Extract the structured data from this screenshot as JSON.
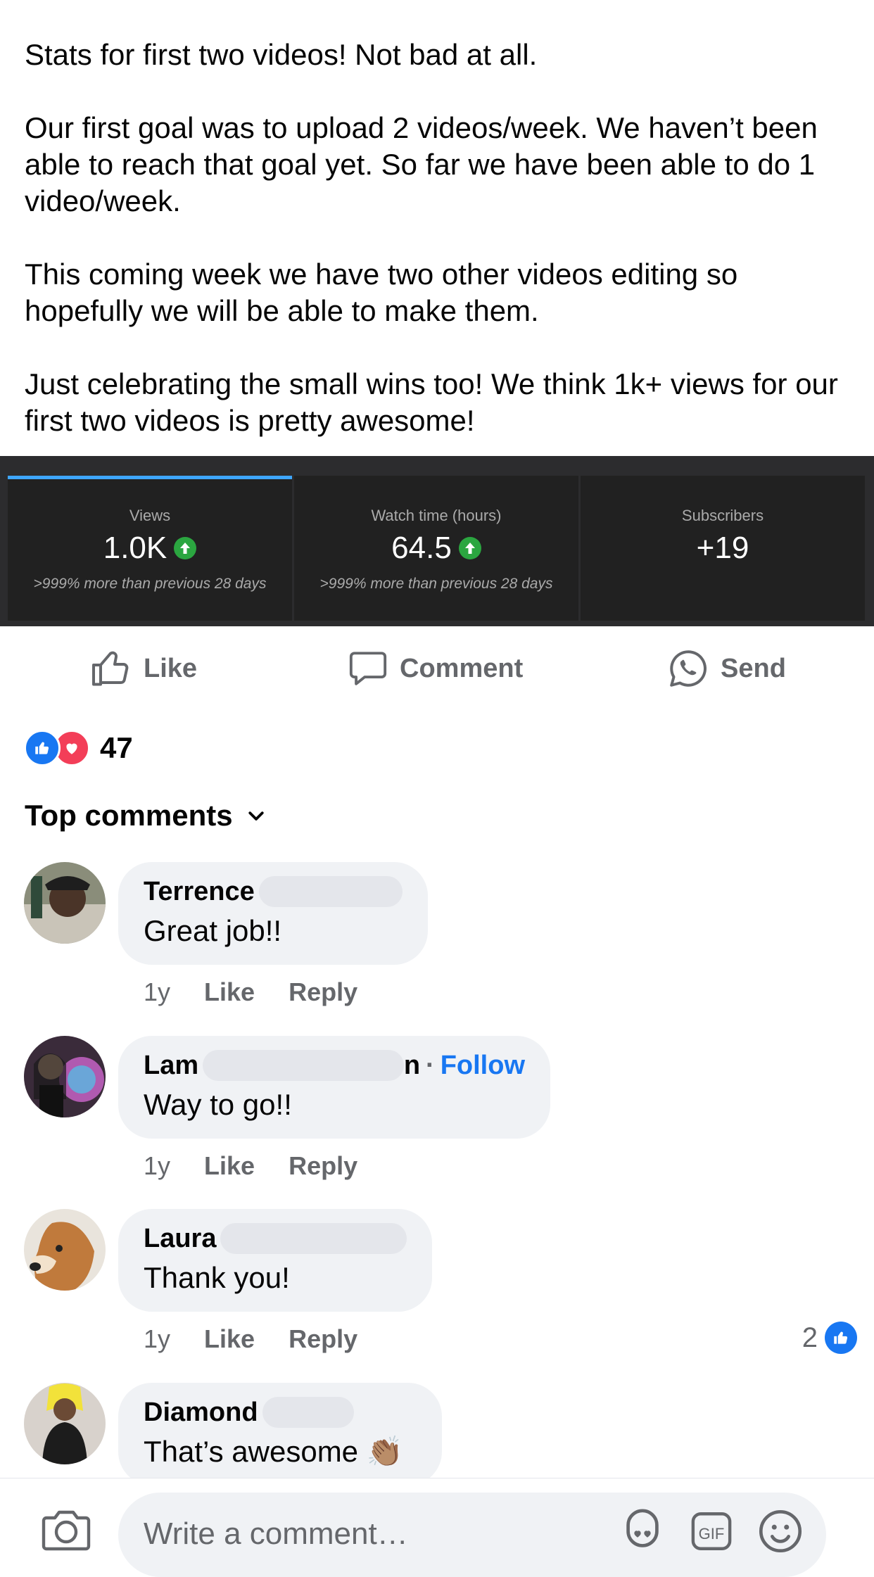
{
  "post": {
    "paragraphs": [
      "Stats for first two videos! Not bad at all.",
      "Our first goal was to upload 2 videos/week. We haven’t been able to reach that goal yet. So far we have been able to do 1 video/week.",
      "This coming week we have two other videos editing so hopefully we will be able to make them.",
      "Just celebrating the small wins too! We think 1k+ views for our first two videos is pretty awesome!"
    ]
  },
  "analytics": {
    "cards": [
      {
        "label": "Views",
        "value": "1.0K",
        "note": ">999% more than previous 28 days"
      },
      {
        "label": "Watch time (hours)",
        "value": "64.5",
        "note": ">999% more than previous 28 days"
      },
      {
        "label": "Subscribers",
        "value": "+19",
        "note": ""
      }
    ],
    "accent": "#3ea6ff",
    "up_color": "#2ba640"
  },
  "actions": {
    "like": "Like",
    "comment": "Comment",
    "send": "Send"
  },
  "reactions": {
    "count": "47",
    "types": [
      "like-icon",
      "love-icon"
    ]
  },
  "comments_header": "Top comments",
  "comments": [
    {
      "name": "Terrence",
      "text": "Great job!!",
      "age": "1y",
      "like": "Like",
      "reply": "Reply"
    },
    {
      "name": "Lam",
      "name_tail": "n",
      "follow": "Follow",
      "text": "Way to go!!",
      "age": "1y",
      "like": "Like",
      "reply": "Reply"
    },
    {
      "name": "Laura",
      "text": "Thank you!",
      "age": "1y",
      "like": "Like",
      "reply": "Reply",
      "likes": "2"
    },
    {
      "name": "Diamond",
      "text": "That’s awesome",
      "emoji": "👏🏽"
    }
  ],
  "composer": {
    "placeholder": "Write a comment…"
  },
  "colors": {
    "fb_blue": "#1877f2",
    "bubble": "#f0f2f5",
    "muted": "#65676b"
  }
}
